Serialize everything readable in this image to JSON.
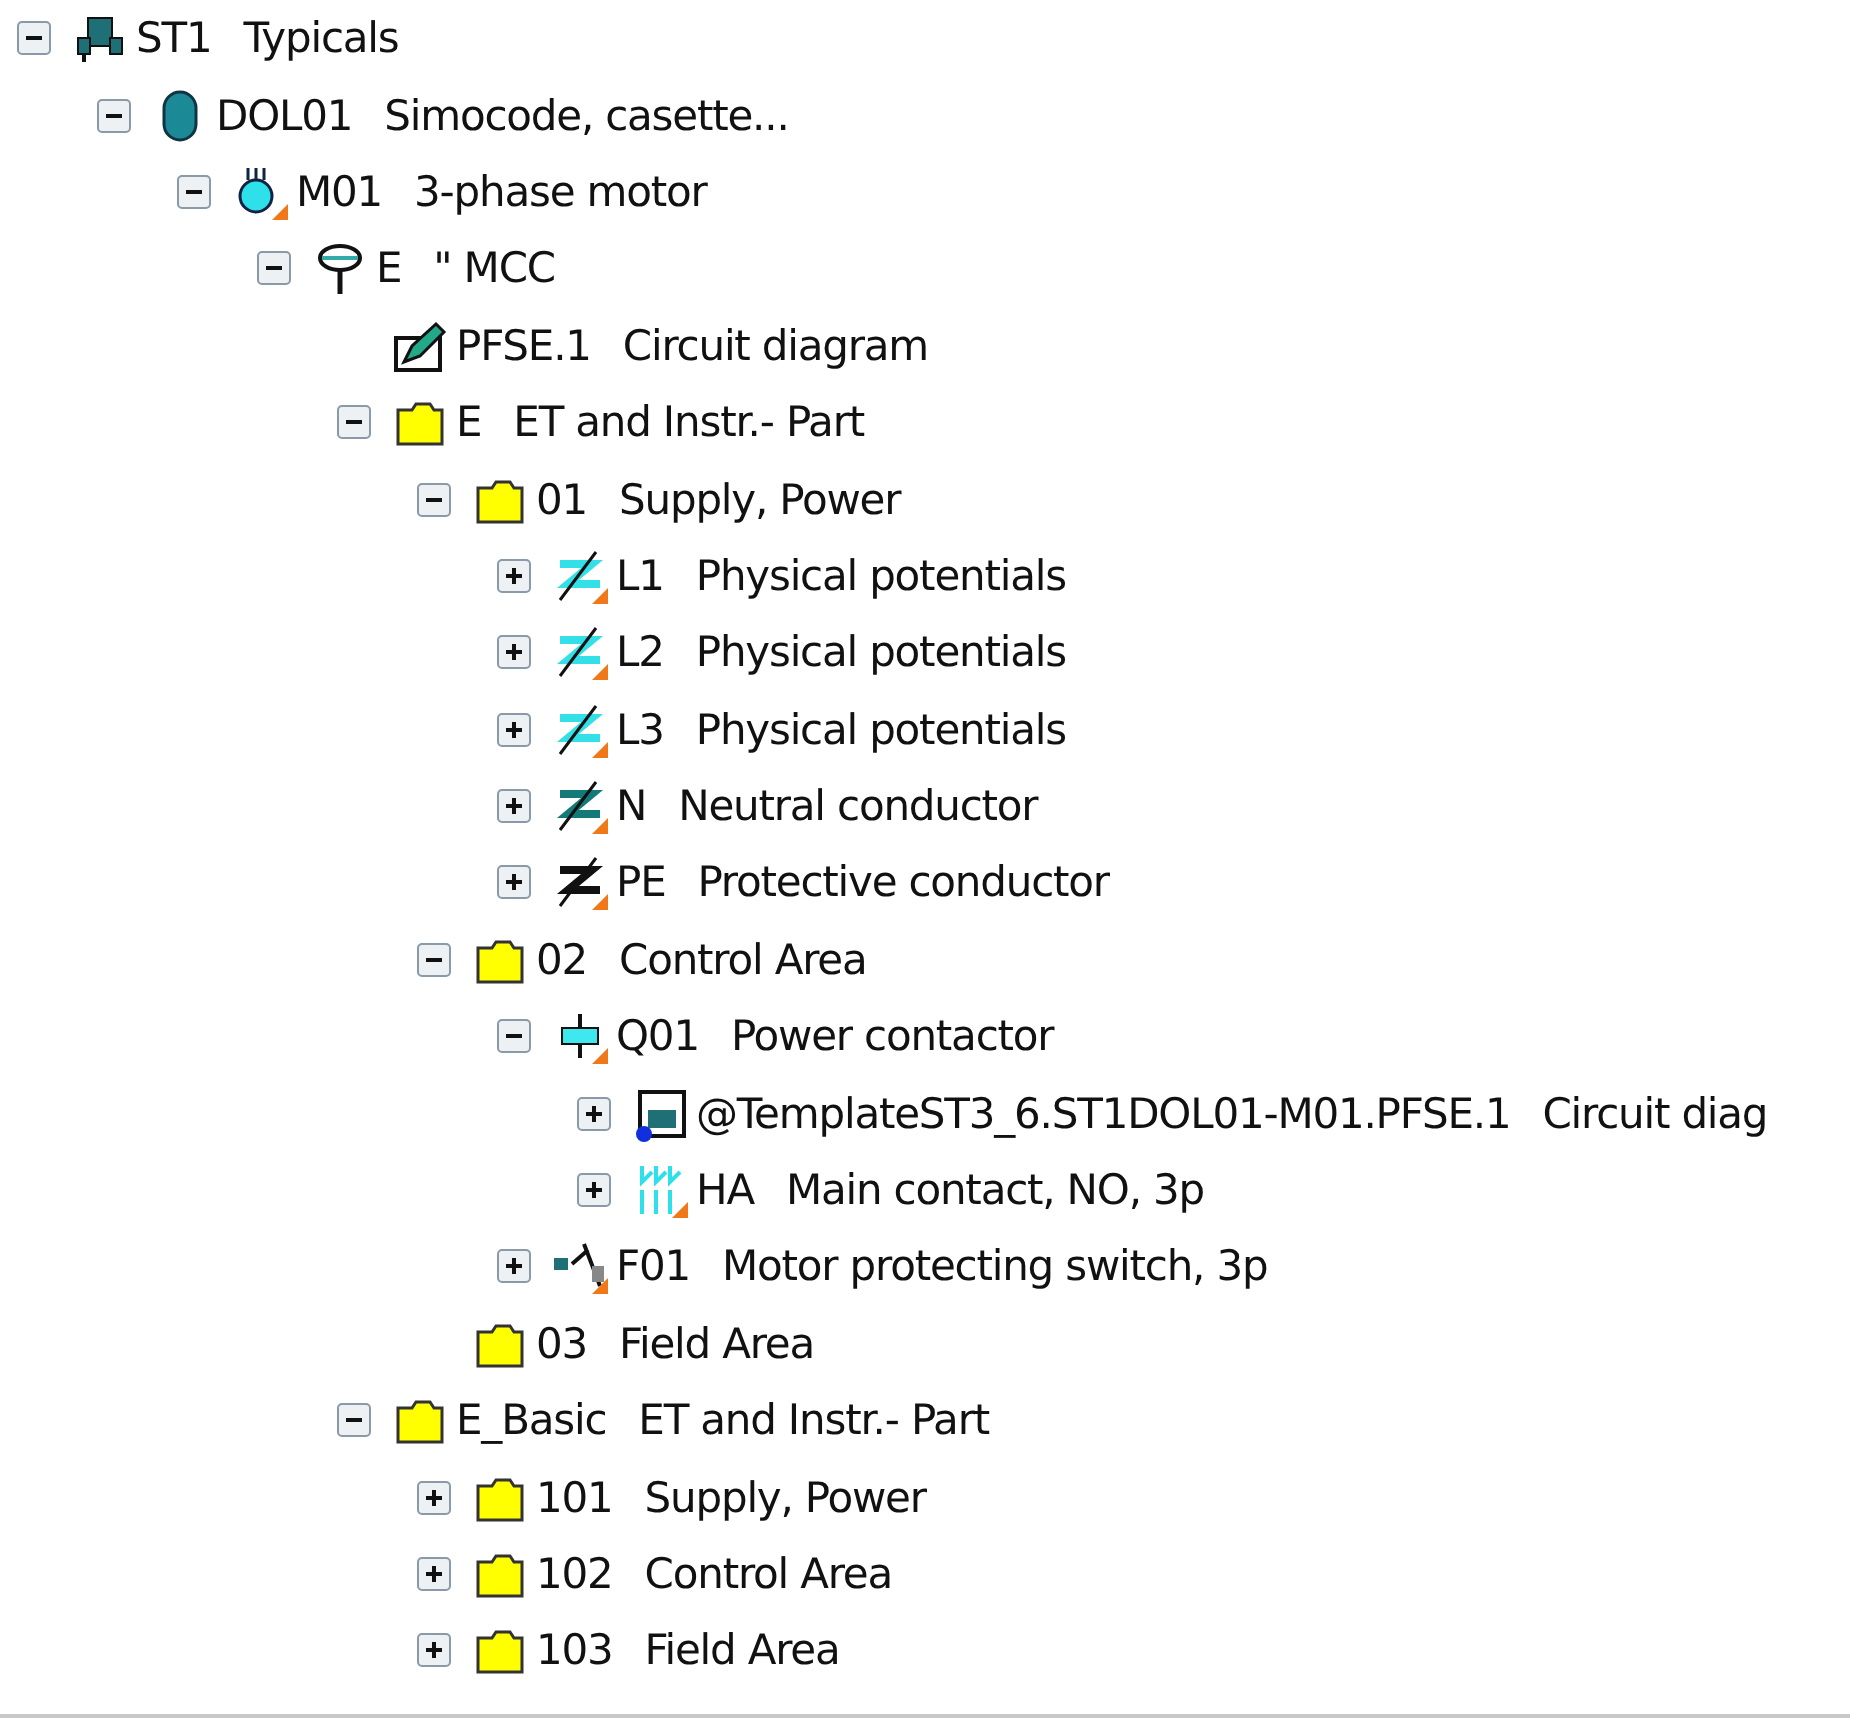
{
  "tree": [
    {
      "kind": "station",
      "code": "ST1",
      "text": "Typicals",
      "expanded": true,
      "children": [
        {
          "kind": "device",
          "code": "DOL01",
          "text": "Simocode, casette...",
          "expanded": true,
          "children": [
            {
              "kind": "motor",
              "code": "M01",
              "text": "3-phase motor",
              "expanded": true,
              "children": [
                {
                  "kind": "location",
                  "code": "E",
                  "text": "\" MCC",
                  "expanded": true,
                  "children": [
                    {
                      "kind": "diagram",
                      "code": "PFSE.1",
                      "text": "Circuit diagram"
                    },
                    {
                      "kind": "folder",
                      "code": "E",
                      "text": "ET and Instr.- Part",
                      "expanded": true,
                      "children": [
                        {
                          "kind": "folder",
                          "code": "01",
                          "text": "Supply, Power",
                          "expanded": true,
                          "children": [
                            {
                              "kind": "potential",
                              "code": "L1",
                              "text": "Physical potentials",
                              "expanded": false,
                              "color": "#33e0e8"
                            },
                            {
                              "kind": "potential",
                              "code": "L2",
                              "text": "Physical potentials",
                              "expanded": false,
                              "color": "#33e0e8"
                            },
                            {
                              "kind": "potential",
                              "code": "L3",
                              "text": "Physical potentials",
                              "expanded": false,
                              "color": "#33e0e8"
                            },
                            {
                              "kind": "potential",
                              "code": "N",
                              "text": "Neutral conductor",
                              "expanded": false,
                              "color": "#137a7a"
                            },
                            {
                              "kind": "potential",
                              "code": "PE",
                              "text": "Protective conductor",
                              "expanded": false,
                              "color": "#111111"
                            }
                          ]
                        },
                        {
                          "kind": "folder",
                          "code": "02",
                          "text": "Control Area",
                          "expanded": true,
                          "children": [
                            {
                              "kind": "contactor",
                              "code": "Q01",
                              "text": "Power contactor",
                              "expanded": true,
                              "children": [
                                {
                                  "kind": "template",
                                  "code": "@TemplateST3_6.ST1DOL01-M01.PFSE.1",
                                  "text": "Circuit diag",
                                  "expanded": false
                                },
                                {
                                  "kind": "contact",
                                  "code": "HA",
                                  "text": "Main contact, NO, 3p",
                                  "expanded": false
                                }
                              ]
                            },
                            {
                              "kind": "switch",
                              "code": "F01",
                              "text": "Motor protecting switch, 3p",
                              "expanded": false
                            }
                          ]
                        },
                        {
                          "kind": "folder",
                          "code": "03",
                          "text": "Field Area"
                        }
                      ]
                    },
                    {
                      "kind": "folder",
                      "code": "E_Basic",
                      "text": "ET and Instr.- Part",
                      "expanded": true,
                      "children": [
                        {
                          "kind": "folder",
                          "code": "101",
                          "text": "Supply, Power",
                          "expanded": false
                        },
                        {
                          "kind": "folder",
                          "code": "102",
                          "text": "Control Area",
                          "expanded": false
                        },
                        {
                          "kind": "folder",
                          "code": "103",
                          "text": "Field Area",
                          "expanded": false
                        }
                      ]
                    }
                  ]
                }
              ]
            }
          ]
        }
      ]
    }
  ]
}
